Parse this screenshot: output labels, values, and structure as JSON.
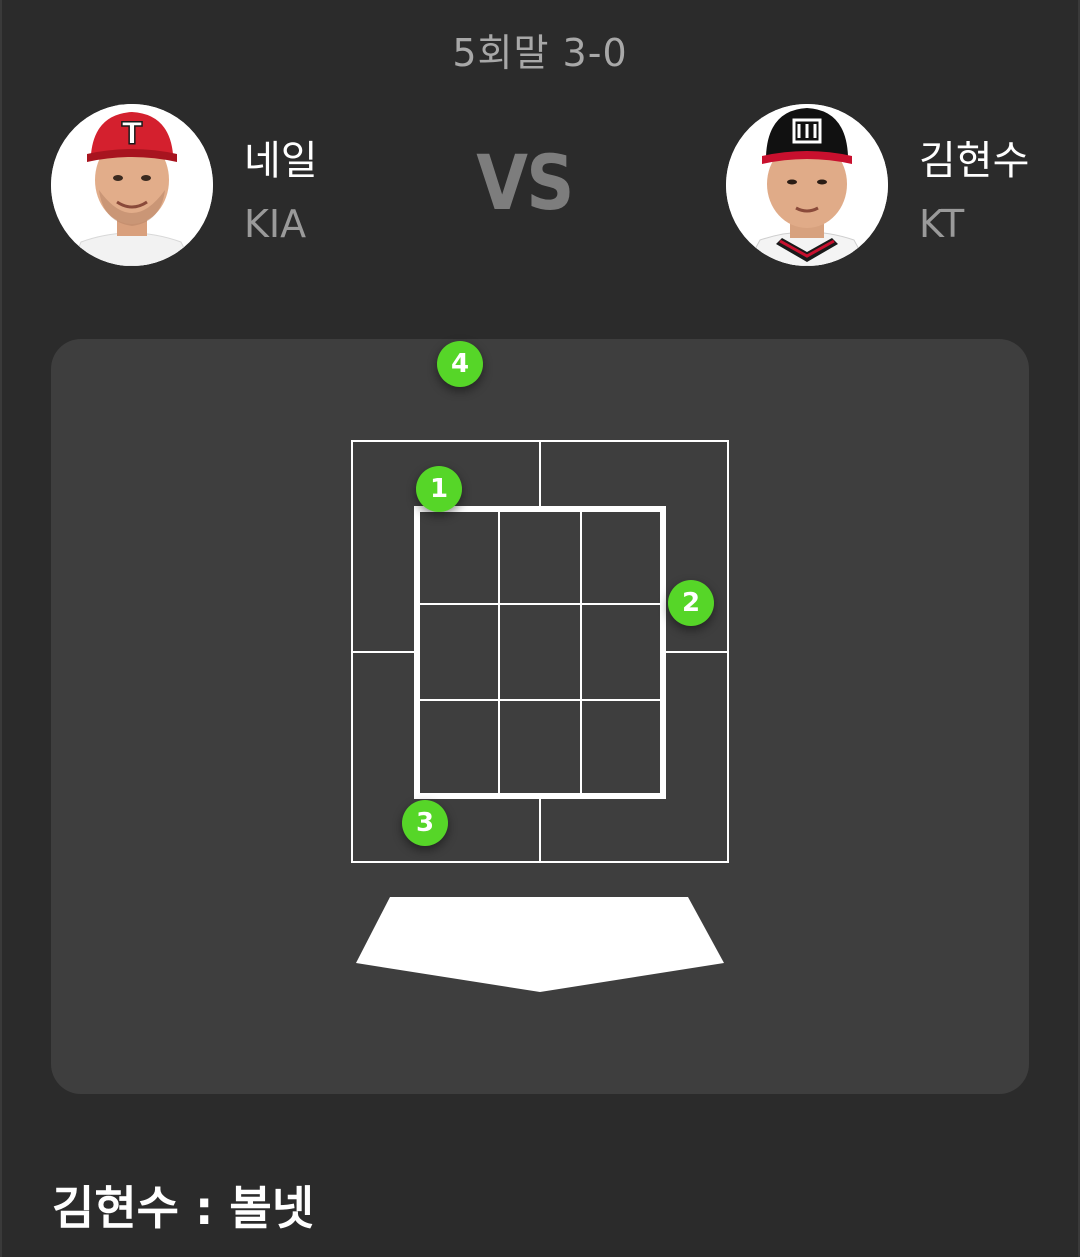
{
  "header": {
    "inning_score": "5회말 3-0"
  },
  "pitcher": {
    "name": "네일",
    "team": "KIA",
    "cap_color": "#d4202e",
    "cap_letter": "T"
  },
  "versus_label": "VS",
  "batter": {
    "name": "김현수",
    "team": "KT",
    "cap_color": "#111111"
  },
  "pitches": [
    {
      "number": "1"
    },
    {
      "number": "2"
    },
    {
      "number": "3"
    },
    {
      "number": "4"
    }
  ],
  "colors": {
    "background": "#2b2b2b",
    "panel": "#3e3e3e",
    "marker": "#56d628",
    "zone_line": "#ffffff"
  },
  "result": {
    "text": "김현수 : 볼넷"
  }
}
